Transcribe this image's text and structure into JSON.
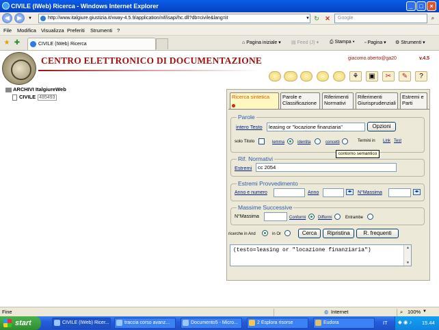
{
  "window": {
    "title": "CIVILE (IWeb) Ricerca - Windows Internet Explorer"
  },
  "address": {
    "url": "http://www.italgiure.giustizia.it/xway-4.5.9/application/nif/isapi/hc.dll?db=civile&lang=it"
  },
  "search": {
    "placeholder": "Google"
  },
  "menu": [
    "File",
    "Modifica",
    "Visualizza",
    "Preferiti",
    "Strumenti",
    "?"
  ],
  "browser_tab": {
    "label": "CIVILE (IWeb) Ricerca"
  },
  "commands": {
    "home": "Pagina iniziale",
    "feed": "Feed (J)",
    "print": "Stampa",
    "page": "Pagina",
    "tools": "Strumenti"
  },
  "header": {
    "title": "CENTRO ELETTRONICO DI DOCUMENTAZIONE",
    "user": "giacomo.oberto@ga20",
    "version": "v.4.5"
  },
  "tree": {
    "root": "ARCHIVI ItalgiureWeb",
    "child": {
      "name": "CIVILE",
      "count": "485493"
    }
  },
  "tabs": [
    {
      "label": "Ricerca sintetica"
    },
    {
      "label": "Parole e Classificazione"
    },
    {
      "label": "Riferimenti Normativi"
    },
    {
      "label": "Riferimenti Giurisprudenziali"
    },
    {
      "label": "Estremi e Parti"
    }
  ],
  "parole": {
    "legend": "Parole",
    "field_label": "intero Testo",
    "value": "leasing or \"locazione finanziaria\"",
    "options_button": "Opzioni",
    "solo_titolo": "solo Titolo",
    "lemma": "lemma",
    "identita": "identita",
    "concetti": "concetti",
    "termini_in": "Termini in",
    "link": "Link",
    "test": "Test",
    "tooltip": "contorno semantico"
  },
  "rif_normativi": {
    "legend": "Rif. Normativi",
    "label": "Estremi",
    "value": "cc 2054"
  },
  "estremi": {
    "legend": "Estremi Provvedimento",
    "anno_numero": "Anno e numero",
    "anno": "Anno",
    "massima": "N°Massima"
  },
  "massime": {
    "legend": "Massime Successive",
    "massima": "N°Massima",
    "conformi": "Conformi",
    "difformi": "Difformi",
    "entrambe": "Entrambe"
  },
  "actions": {
    "and_label": "ricerche in And",
    "or_label": "in Or",
    "cerca": "Cerca",
    "ripristina": "Ripristina",
    "frequenti": "R. frequenti"
  },
  "query": "(testo=leasing or \"locazione finanziaria\")",
  "status": {
    "left": "Fine",
    "zone": "Internet",
    "zoom": "100%"
  },
  "taskbar": {
    "start": "start",
    "tasks": [
      "CIVILE (IWeb) Ricer...",
      "traccia corso avanz...",
      "Documento5 - Micro...",
      "2 Esplora risorse",
      "Eudora"
    ],
    "lang": "IT",
    "clock": "15.44"
  }
}
